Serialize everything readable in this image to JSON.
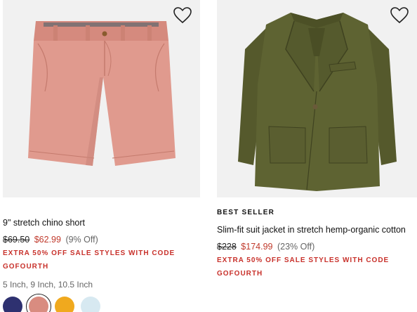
{
  "products": [
    {
      "badge": "",
      "title": "9\" stretch chino short",
      "original_price": "$69.50",
      "sale_price": "$62.99",
      "discount": "(9% Off)",
      "promo": "EXTRA 50% OFF SALE STYLES WITH CODE GOFOURTH",
      "sizes": "5 Inch, 9 Inch, 10.5 Inch",
      "swatches": [
        {
          "name": "navy",
          "color": "#2e3170"
        },
        {
          "name": "salmon",
          "color": "#d98c80",
          "selected": true
        },
        {
          "name": "yellow",
          "color": "#f0a91e"
        },
        {
          "name": "light-blue",
          "color": "#d7e9f1"
        }
      ],
      "image_color": "#e09a8e",
      "favorite_icon": "heart-outline-icon"
    },
    {
      "badge": "BEST SELLER",
      "title": "Slim-fit suit jacket in stretch hemp-organic cotton",
      "original_price": "$228",
      "sale_price": "$174.99",
      "discount": "(23% Off)",
      "promo": "EXTRA 50% OFF SALE STYLES WITH CODE GOFOURTH",
      "image_color": "#5e6332",
      "favorite_icon": "heart-outline-icon"
    }
  ],
  "colors": {
    "sale_red": "#c0392b",
    "promo_red": "#c8312b",
    "image_bg": "#f1f1f1"
  }
}
